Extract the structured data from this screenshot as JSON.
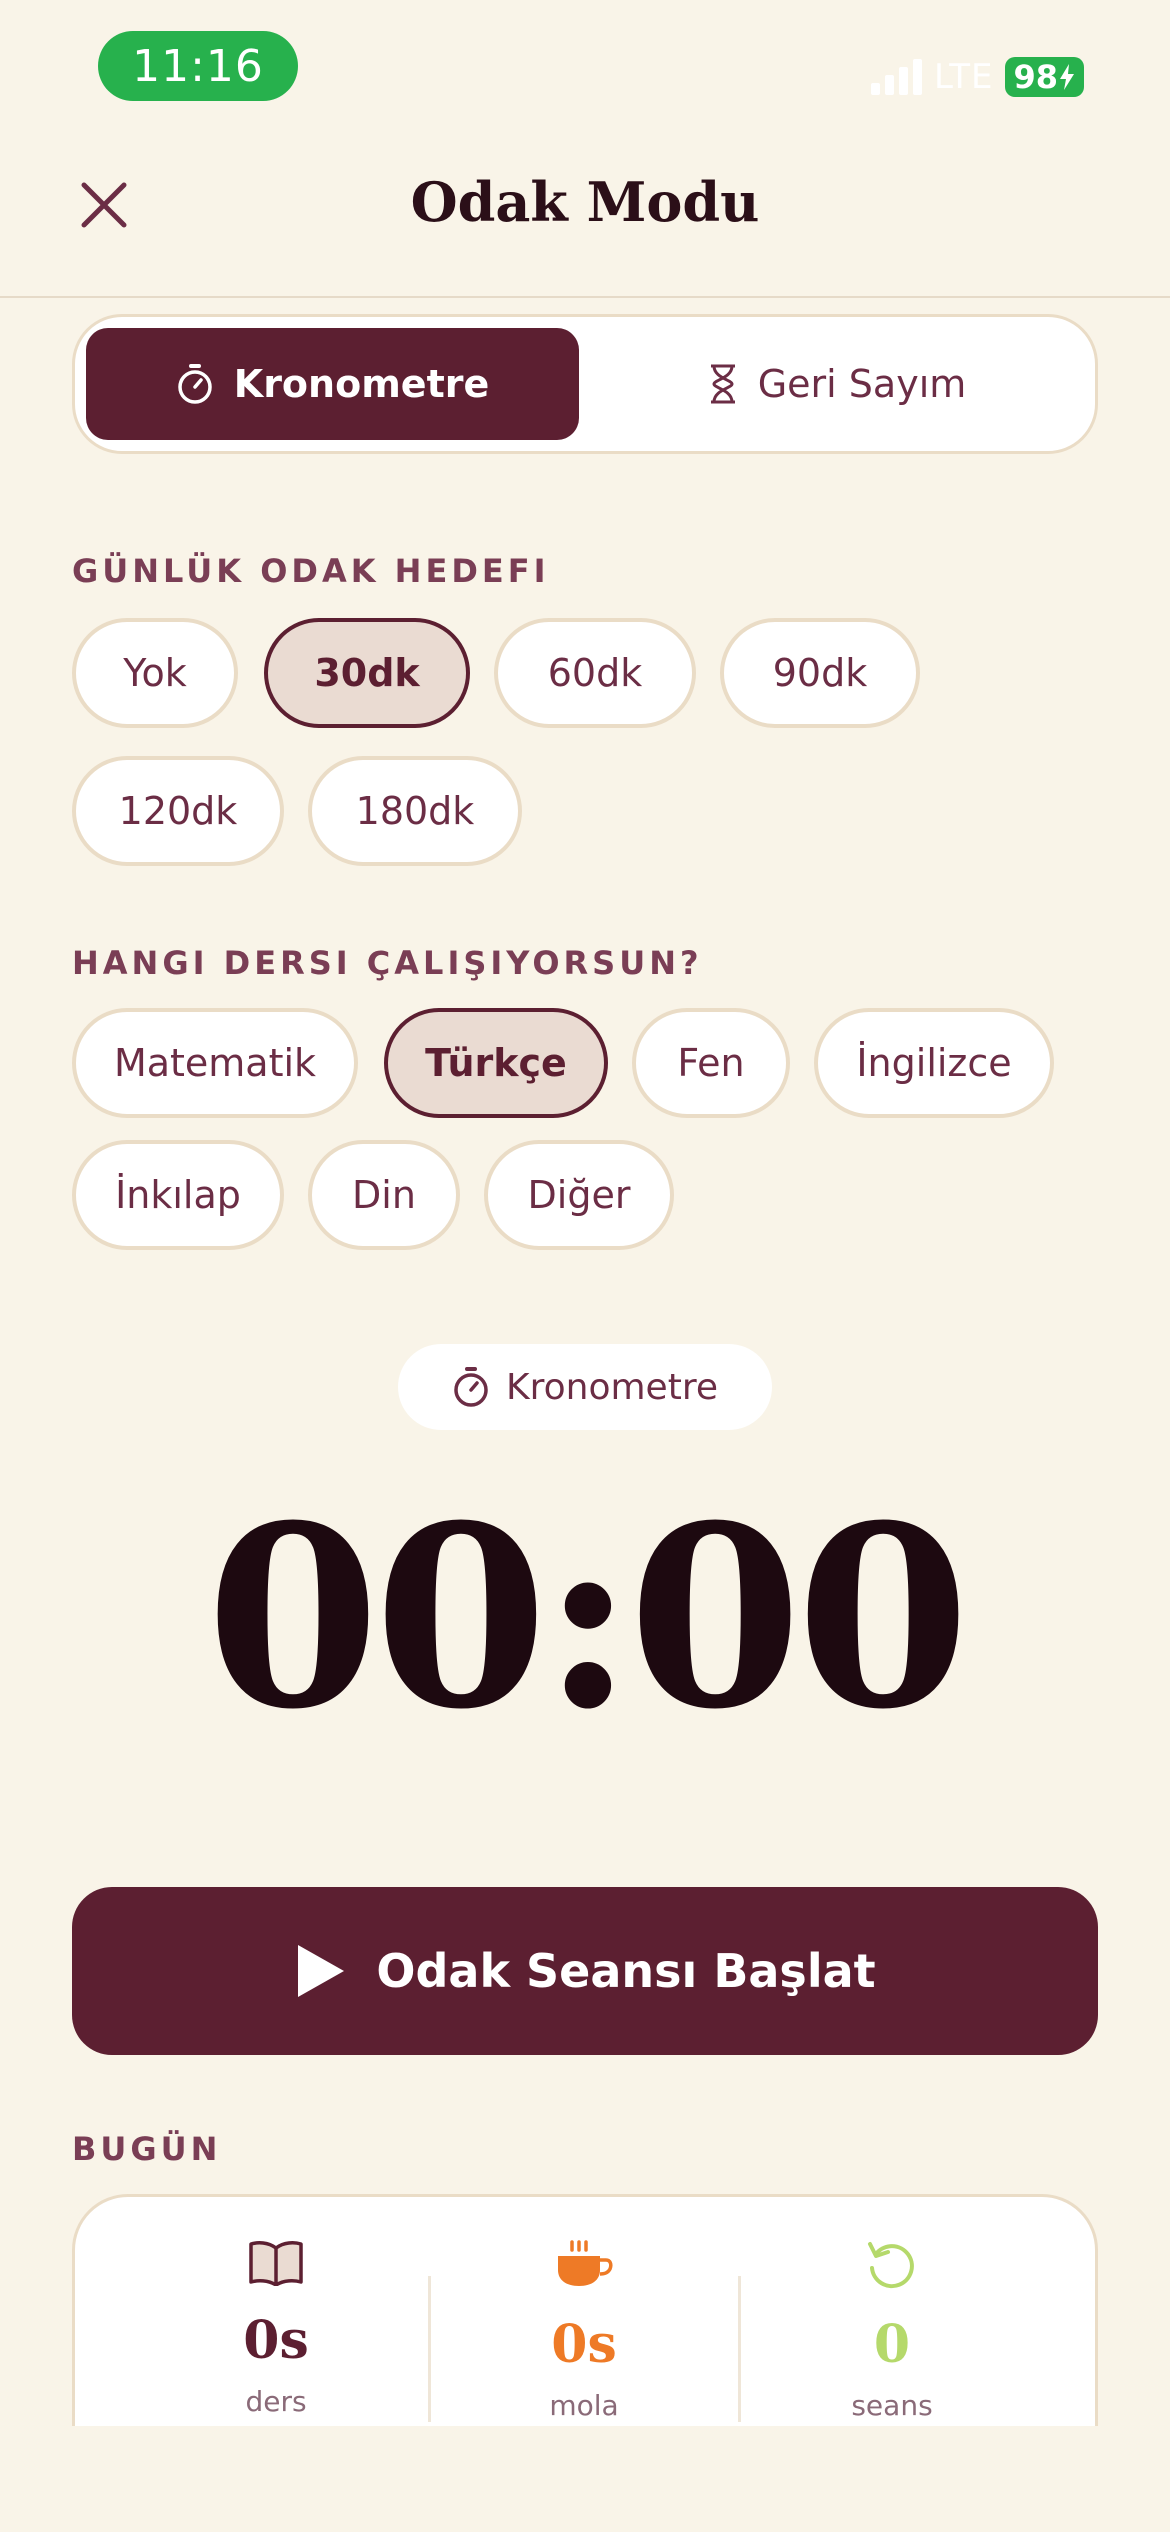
{
  "status_bar": {
    "time": "11:16",
    "network": "LTE",
    "battery": "98"
  },
  "header": {
    "title": "Odak Modu"
  },
  "mode_tabs": [
    {
      "label": "Kronometre",
      "icon": "stopwatch-icon",
      "active": true
    },
    {
      "label": "Geri Sayım",
      "icon": "hourglass-icon",
      "active": false
    }
  ],
  "goal_section": {
    "label": "GÜNLÜK ODAK HEDEFI",
    "options": [
      "Yok",
      "30dk",
      "60dk",
      "90dk",
      "120dk",
      "180dk"
    ],
    "selected": "30dk"
  },
  "subject_section": {
    "label": "HANGI DERSI ÇALIŞIYORSUN?",
    "options": [
      "Matematik",
      "Türkçe",
      "Fen",
      "İngilizce",
      "İnkılap",
      "Din",
      "Diğer"
    ],
    "selected": "Türkçe"
  },
  "timer": {
    "mode_label": "Kronometre",
    "display": "00:00"
  },
  "start_button": {
    "label": "Odak Seansı Başlat"
  },
  "today": {
    "label": "BUGÜN",
    "stats": [
      {
        "value": "0s",
        "label": "ders",
        "icon": "book-icon",
        "color": "#5C1F31"
      },
      {
        "value": "0s",
        "label": "mola",
        "icon": "coffee-icon",
        "color": "#EE7A26"
      },
      {
        "value": "0",
        "label": "seans",
        "icon": "refresh-icon",
        "color": "#B5D96B"
      }
    ]
  },
  "colors": {
    "accent": "#5C1F31",
    "background": "#F9F4E8",
    "status_green": "#27B14D"
  }
}
